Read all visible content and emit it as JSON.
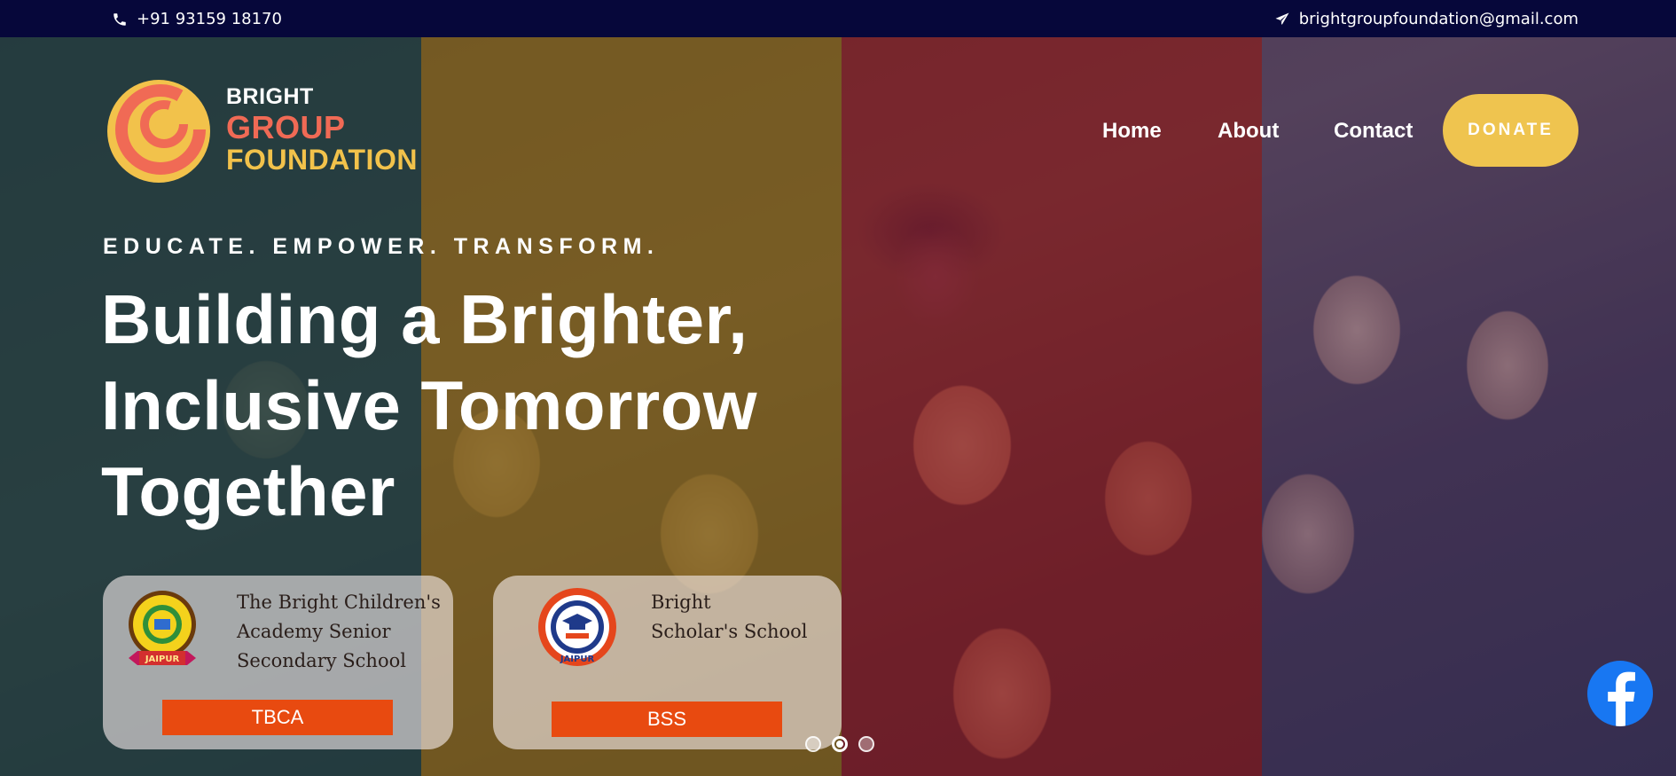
{
  "topbar": {
    "phone": "+91 93159 18170",
    "email": "brightgroupfoundation@gmail.com",
    "phone_icon": "phone-icon",
    "email_icon": "paper-plane-icon"
  },
  "logo": {
    "line1": "BRIGHT",
    "line2": "GROUP",
    "line3": "FOUNDATION"
  },
  "nav": {
    "items": [
      {
        "label": "Home"
      },
      {
        "label": "About"
      },
      {
        "label": "Contact"
      }
    ],
    "donate_label": "DONATE"
  },
  "hero": {
    "tagline": "EDUCATE. EMPOWER. TRANSFORM.",
    "headline_lines": [
      "Building a Brighter,",
      "Inclusive Tomorrow",
      "Together"
    ]
  },
  "schools": [
    {
      "name_lines": [
        "The Bright Children's",
        "Academy Senior",
        "Secondary School"
      ],
      "button": "TBCA",
      "emblem_text": "JAIPUR"
    },
    {
      "name_lines": [
        "Bright",
        "Scholar's School"
      ],
      "button": "BSS",
      "emblem_text": "JAIPUR"
    }
  ],
  "slider": {
    "count": 3,
    "active": 2
  },
  "colors": {
    "topbar_bg": "#06073a",
    "donate_bg": "#efc44f",
    "brand_coral": "#f06a55",
    "brand_yellow": "#f2c24b",
    "button_orange": "#e84a10",
    "facebook_blue": "#1877f2"
  },
  "social": {
    "icon": "facebook-icon"
  }
}
